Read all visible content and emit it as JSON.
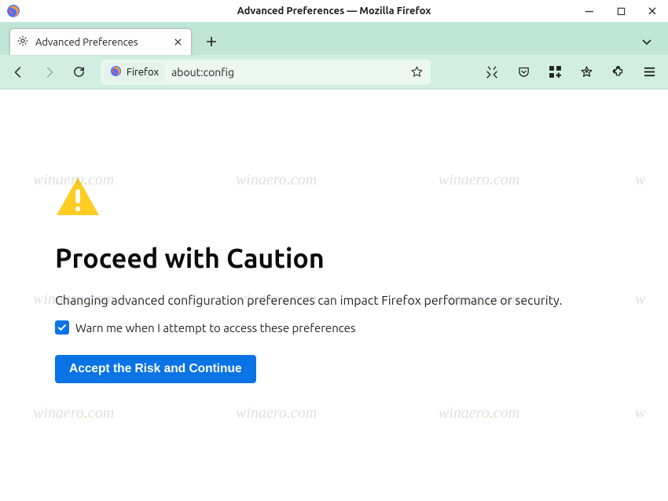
{
  "window": {
    "title": "Advanced Preferences — Mozilla Firefox"
  },
  "tab": {
    "title": "Advanced Preferences"
  },
  "urlbar": {
    "identity_label": "Firefox",
    "url": "about:config"
  },
  "page": {
    "heading": "Proceed with Caution",
    "description": "Changing advanced configuration preferences can impact Firefox performance or security.",
    "checkbox_label": "Warn me when I attempt to access these preferences",
    "checkbox_checked": true,
    "accept_button": "Accept the Risk and Continue"
  },
  "watermark": "winaero.com"
}
